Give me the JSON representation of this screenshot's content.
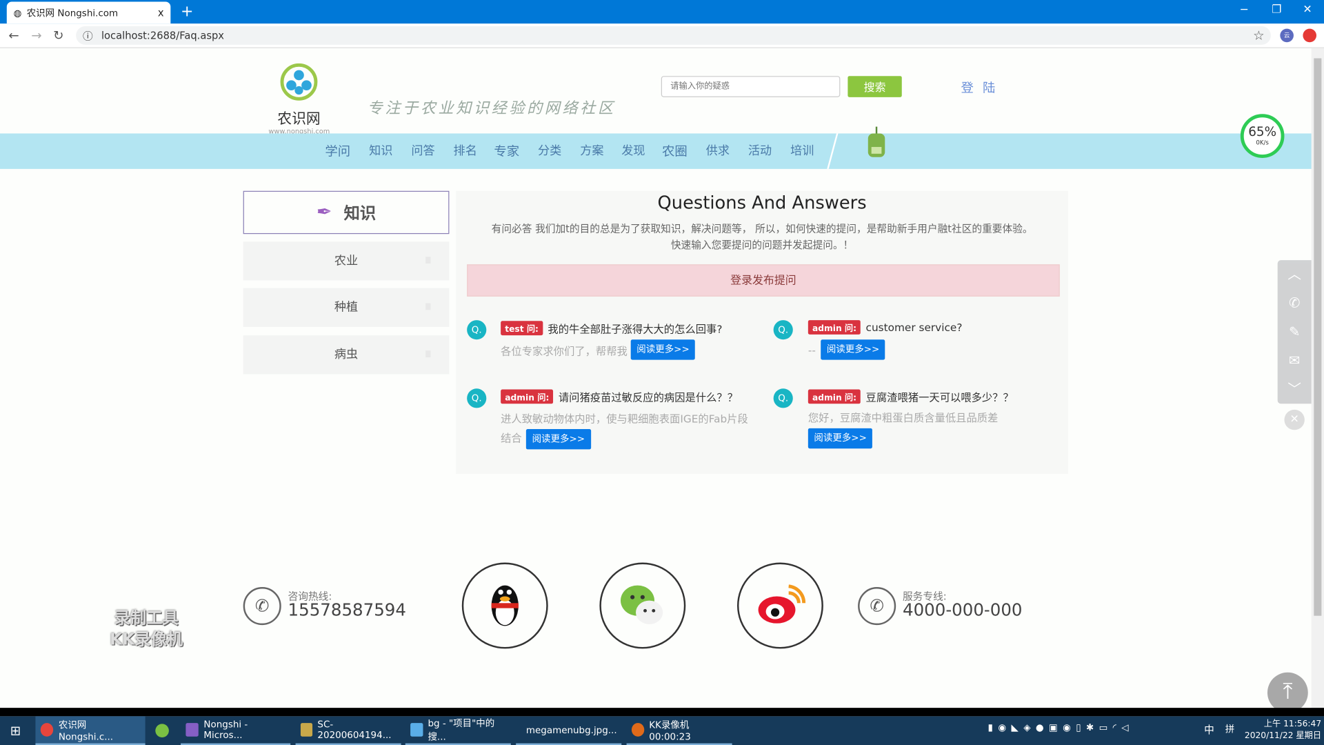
{
  "browser": {
    "tab_title": "农识网 Nongshi.com",
    "url": "localhost:2688/Faq.aspx",
    "new_tab": "+",
    "close": "x",
    "ext1": "云",
    "min": "−",
    "max": "❐",
    "close_win": "✕"
  },
  "header": {
    "logo_text": "农识网",
    "logo_sub": "www.nongshi.com",
    "slogan": "专注于农业知识经验的网络社区",
    "search_placeholder": "请输入你的疑惑",
    "search_button": "搜索",
    "login": "登 陆"
  },
  "nav": [
    "学问",
    "知识",
    "问答",
    "排名",
    "专家",
    "分类",
    "方案",
    "发现",
    "农圈",
    "供求",
    "活动",
    "培训"
  ],
  "speed": {
    "percent": "65%",
    "rate": "0K/s"
  },
  "sidebar": {
    "title": "知识",
    "items": [
      "农业",
      "种植",
      "病虫"
    ]
  },
  "main": {
    "title": "Questions And Answers",
    "desc1": "有问必答 我们加t的目的总是为了获取知识，解决问题等， 所以，如何快速的提问，是帮助新手用户融t社区的重要体验。",
    "desc2": "快速输入您要提问的问题并发起提问。！",
    "post_button": "登录发布提问",
    "q_icon": "Q.",
    "more": "阅读更多>>",
    "questions": [
      {
        "tag": "test 问:",
        "question": "我的牛全部肚子涨得大大的怎么回事?",
        "answer": "各位专家求你们了，帮帮我"
      },
      {
        "tag": "admin 问:",
        "question": "customer service?",
        "answer": "--"
      },
      {
        "tag": "admin 问:",
        "question": "请问猪疫苗过敏反应的病因是什么？？",
        "answer": "进人致敏动物体内时，使与耙细胞表面IGE的Fab片段结合"
      },
      {
        "tag": "admin 问:",
        "question": "豆腐渣喂猪一天可以喂多少？？",
        "answer": "您好，豆腐渣中粗蛋白质含量低且品质差"
      }
    ]
  },
  "footer": {
    "hotline_label": "咨询热线:",
    "hotline": "15578587594",
    "service_label": "服务专线:",
    "service": "4000-000-000"
  },
  "watermark": [
    "录制工具",
    "KK录像机"
  ],
  "taskbar": {
    "items": [
      "农识网 Nongshi.c...",
      "Nongshi - Micros...",
      "SC-20200604194...",
      "bg - \"项目\"中的搜...",
      "megamenubg.jpg...",
      "KK录像机 00:00:23"
    ],
    "ime": "中",
    "ime2": "拼",
    "time": "上午 11:56:47",
    "date": "2020/11/22 星期日"
  }
}
